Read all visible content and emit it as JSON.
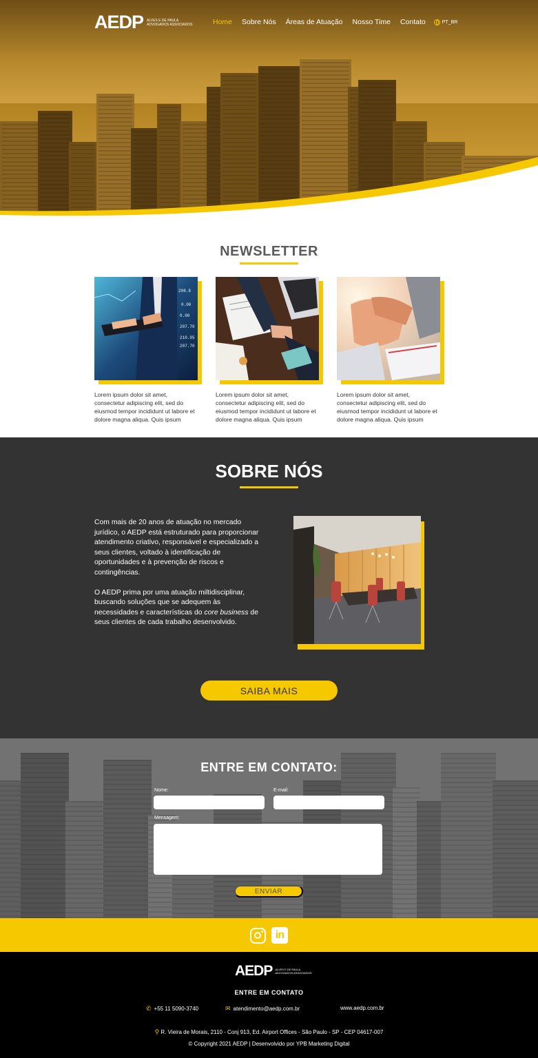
{
  "brand": {
    "logo": "AEDP",
    "subtitle_line1": "ALVES E DE PAULA",
    "subtitle_line2": "ADVOGADOS ASSOCIADOS"
  },
  "nav": {
    "items": [
      "Home",
      "Sobre Nós",
      "Áreas de Atuação",
      "Nosso Time",
      "Contato"
    ],
    "active": "Home",
    "language": "PT_BR"
  },
  "newsletter": {
    "title": "NEWSLETTER",
    "cards": [
      {
        "text": "Lorem ipsum dolor sit amet, consectetur adipiscing elit, sed do eiusmod tempor incididunt ut labore et dolore magna aliqua. Quis ipsum"
      },
      {
        "text": "Lorem ipsum dolor sit amet, consectetur adipiscing elit, sed do eiusmod tempor incididunt ut labore et dolore magna aliqua. Quis ipsum"
      },
      {
        "text": "Lorem ipsum dolor sit amet, consectetur adipiscing elit, sed do eiusmod tempor incididunt ut labore et dolore magna aliqua. Quis ipsum"
      }
    ]
  },
  "sobre": {
    "title": "SOBRE NÓS",
    "paragraph1": "Com mais de 20 anos de atuação no mercado jurídico, o AEDP está estruturado para proporcionar atendimento criativo, responsável e especializado a seus clientes, voltado à identificação de oportunidades e à prevenção de riscos e contingências.",
    "paragraph2_before": "O AEDP prima por uma atuação miltidisciplinar, buscando soluções que se adequem às necessidades e características do ",
    "paragraph2_italic": "core business",
    "paragraph2_after": " de seus clientes de cada trabalho desenvolvido.",
    "button": "SAIBA MAIS"
  },
  "contato": {
    "title": "ENTRE EM CONTATO:",
    "name_label": "Nome:",
    "email_label": "E-mail:",
    "message_label": "Mensagem:",
    "button": "ENVIAR"
  },
  "footer": {
    "title": "ENTRE EM CONTATO",
    "phone": "+55 11 5090-3740",
    "email": "atendimento@aedp.com.br",
    "website": "www.aedp.com.br",
    "address": "R. Vieira de Morais, 2110 - Conj 913, Ed. Airport Offices - São Paulo - SP - CEP 04617-007",
    "copyright": "© Copyright 2021  AEDP | Desenvolvido por YPB Marketing Digital"
  },
  "colors": {
    "accent": "#f6c800",
    "dark": "#333333",
    "footer": "#000000"
  },
  "icons": {
    "language": "globe-icon",
    "social": [
      "instagram-icon",
      "linkedin-icon"
    ],
    "footer": [
      "phone-icon",
      "email-icon",
      "location-icon"
    ]
  }
}
